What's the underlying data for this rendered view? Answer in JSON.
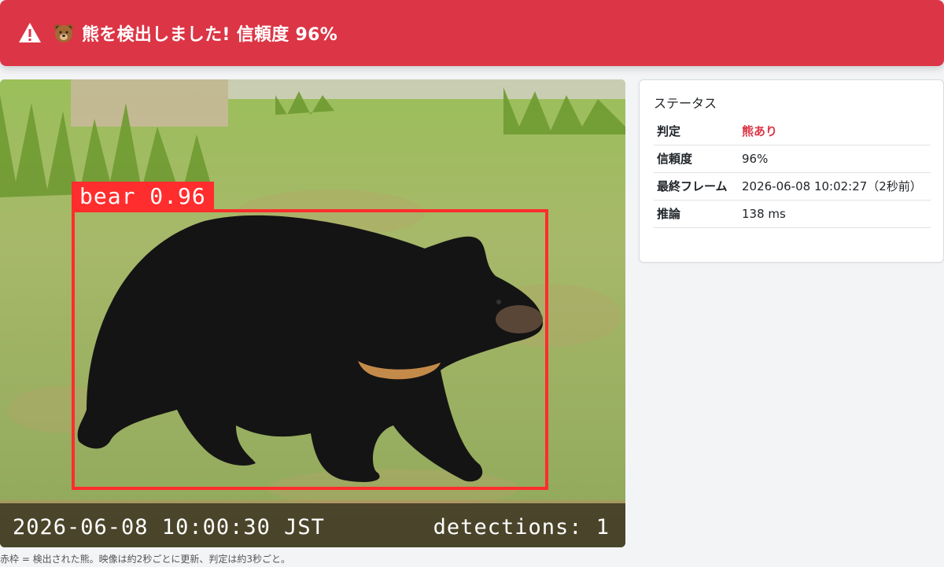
{
  "alert": {
    "icon": "warning-triangle-icon",
    "emoji": "bear-face-icon",
    "message": "熊を検出しました! 信頼度 96%",
    "color": "#dc3545"
  },
  "camera": {
    "detection_label": "bear 0.96",
    "timestamp": "2026-06-08 10:00:30 JST",
    "detections": "detections: 1",
    "box_color": "#ff2d2d"
  },
  "caption": "赤枠 = 検出された熊。映像は約2秒ごとに更新、判定は約3秒ごと。",
  "status": {
    "title": "ステータス",
    "rows": [
      {
        "label": "判定",
        "value": "熊あり"
      },
      {
        "label": "信頼度",
        "value": "96%"
      },
      {
        "label": "最終フレーム",
        "value": "2026-06-08 10:02:27（2秒前）"
      },
      {
        "label": "推論",
        "value": "138 ms"
      }
    ]
  }
}
